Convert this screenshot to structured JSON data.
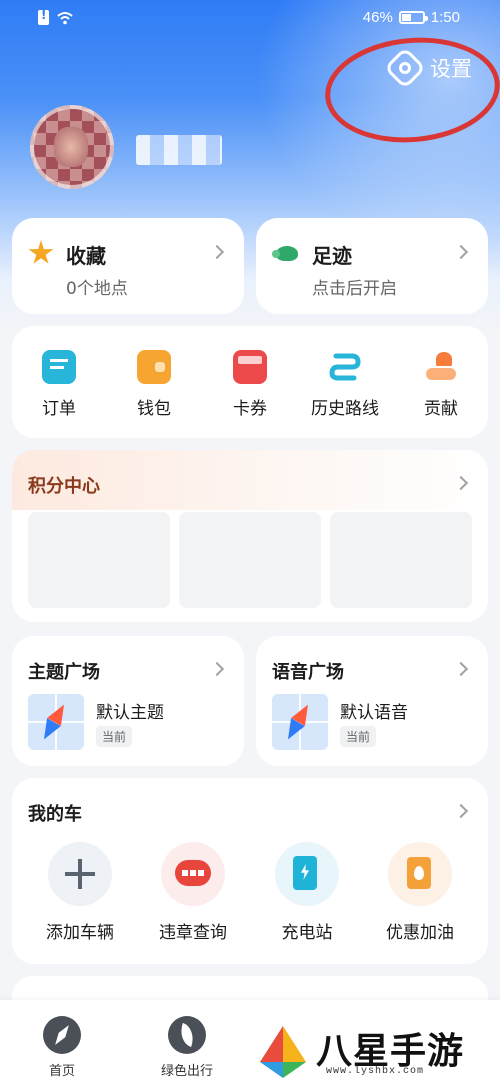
{
  "status_bar": {
    "battery": "46%",
    "time": "1:50"
  },
  "header": {
    "settings_label": "设置"
  },
  "quick_cards": {
    "favorites": {
      "title": "收藏",
      "subtitle": "0个地点"
    },
    "footprints": {
      "title": "足迹",
      "subtitle": "点击后开启"
    }
  },
  "menu": {
    "items": [
      {
        "label": "订单",
        "icon": "order-icon"
      },
      {
        "label": "钱包",
        "icon": "wallet-icon"
      },
      {
        "label": "卡券",
        "icon": "coupon-icon"
      },
      {
        "label": "历史路线",
        "icon": "route-icon"
      },
      {
        "label": "贡献",
        "icon": "contribute-icon"
      }
    ]
  },
  "points_center": {
    "title": "积分中心"
  },
  "theme_square": {
    "title": "主题广场",
    "item": "默认主题",
    "badge": "当前"
  },
  "voice_square": {
    "title": "语音广场",
    "item": "默认语音",
    "badge": "当前"
  },
  "my_car": {
    "title": "我的车",
    "items": [
      {
        "label": "添加车辆",
        "icon": "add-icon"
      },
      {
        "label": "违章查询",
        "icon": "violation-icon"
      },
      {
        "label": "充电站",
        "icon": "charging-icon"
      },
      {
        "label": "优惠加油",
        "icon": "fuel-icon"
      }
    ]
  },
  "bottom_nav": {
    "items": [
      {
        "label": "首页",
        "icon": "compass-icon"
      },
      {
        "label": "绿色出行",
        "icon": "leaf-icon"
      }
    ]
  },
  "watermark": {
    "text": "八星手游网",
    "url": "www.lyshbx.com"
  },
  "colors": {
    "accent": "#2f7cf6",
    "annotation": "#d93636",
    "points_title": "#8a3a1b"
  }
}
